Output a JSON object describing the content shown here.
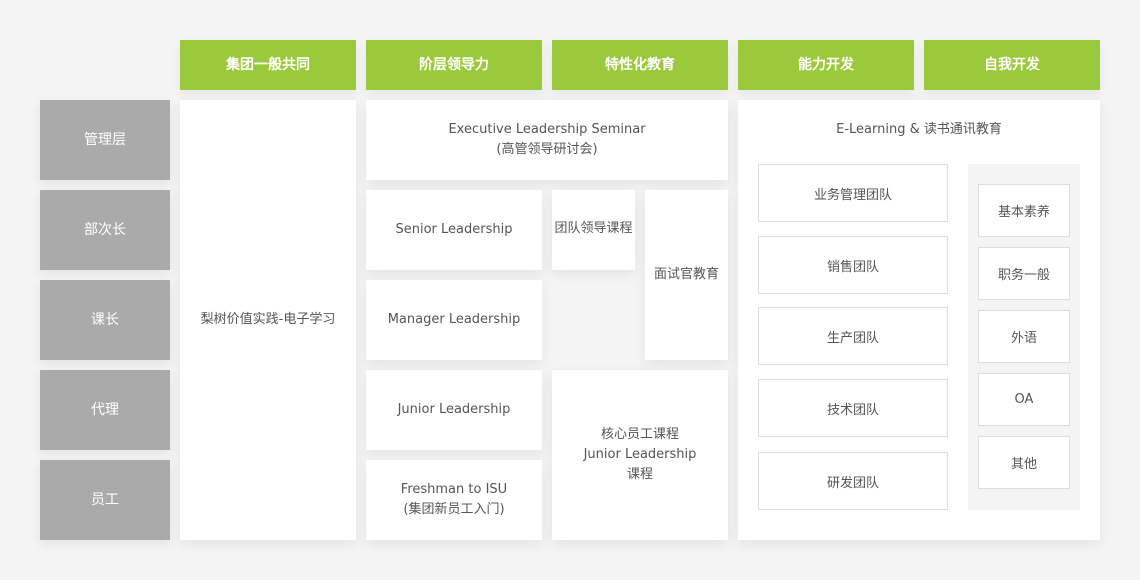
{
  "columns": [
    {
      "label": "集团一般共同"
    },
    {
      "label": "阶层领导力"
    },
    {
      "label": "特性化教育"
    },
    {
      "label": "能力开发"
    },
    {
      "label": "自我开发"
    }
  ],
  "levels": [
    {
      "label": "管理层"
    },
    {
      "label": "部次长"
    },
    {
      "label": "课长"
    },
    {
      "label": "代理"
    },
    {
      "label": "员工"
    }
  ],
  "common": {
    "label": "梨树价值实践-电子学习"
  },
  "leadership": {
    "executive": {
      "line1": "Executive Leadership Seminar",
      "line2": "(高管领导研讨会)"
    },
    "senior": {
      "label": "Senior Leadership"
    },
    "manager": {
      "label": "Manager Leadership"
    },
    "junior": {
      "label": "Junior Leadership"
    },
    "freshman": {
      "line1": "Freshman to ISU",
      "line2": "(集团新员工入门)"
    }
  },
  "specialized": {
    "team_leader": {
      "label": "团队领导课程"
    },
    "interviewer": {
      "label": "面试官教育"
    },
    "core_staff": {
      "line1": "核心员工课程",
      "line2": "Junior Leadership",
      "line3": "课程"
    }
  },
  "development": {
    "title": "E-Learning & 读书通讯教育",
    "teams": [
      {
        "label": "业务管理团队"
      },
      {
        "label": "销售团队"
      },
      {
        "label": "生产团队"
      },
      {
        "label": "技术团队"
      },
      {
        "label": "研发团队"
      }
    ],
    "self": [
      {
        "label": "基本素养"
      },
      {
        "label": "职务一般"
      },
      {
        "label": "外语"
      },
      {
        "label": "OA"
      },
      {
        "label": "其他"
      }
    ]
  },
  "colors": {
    "header_green": "#9aca3c",
    "level_gray": "#aaaaaa",
    "background": "#f4f4f4"
  }
}
